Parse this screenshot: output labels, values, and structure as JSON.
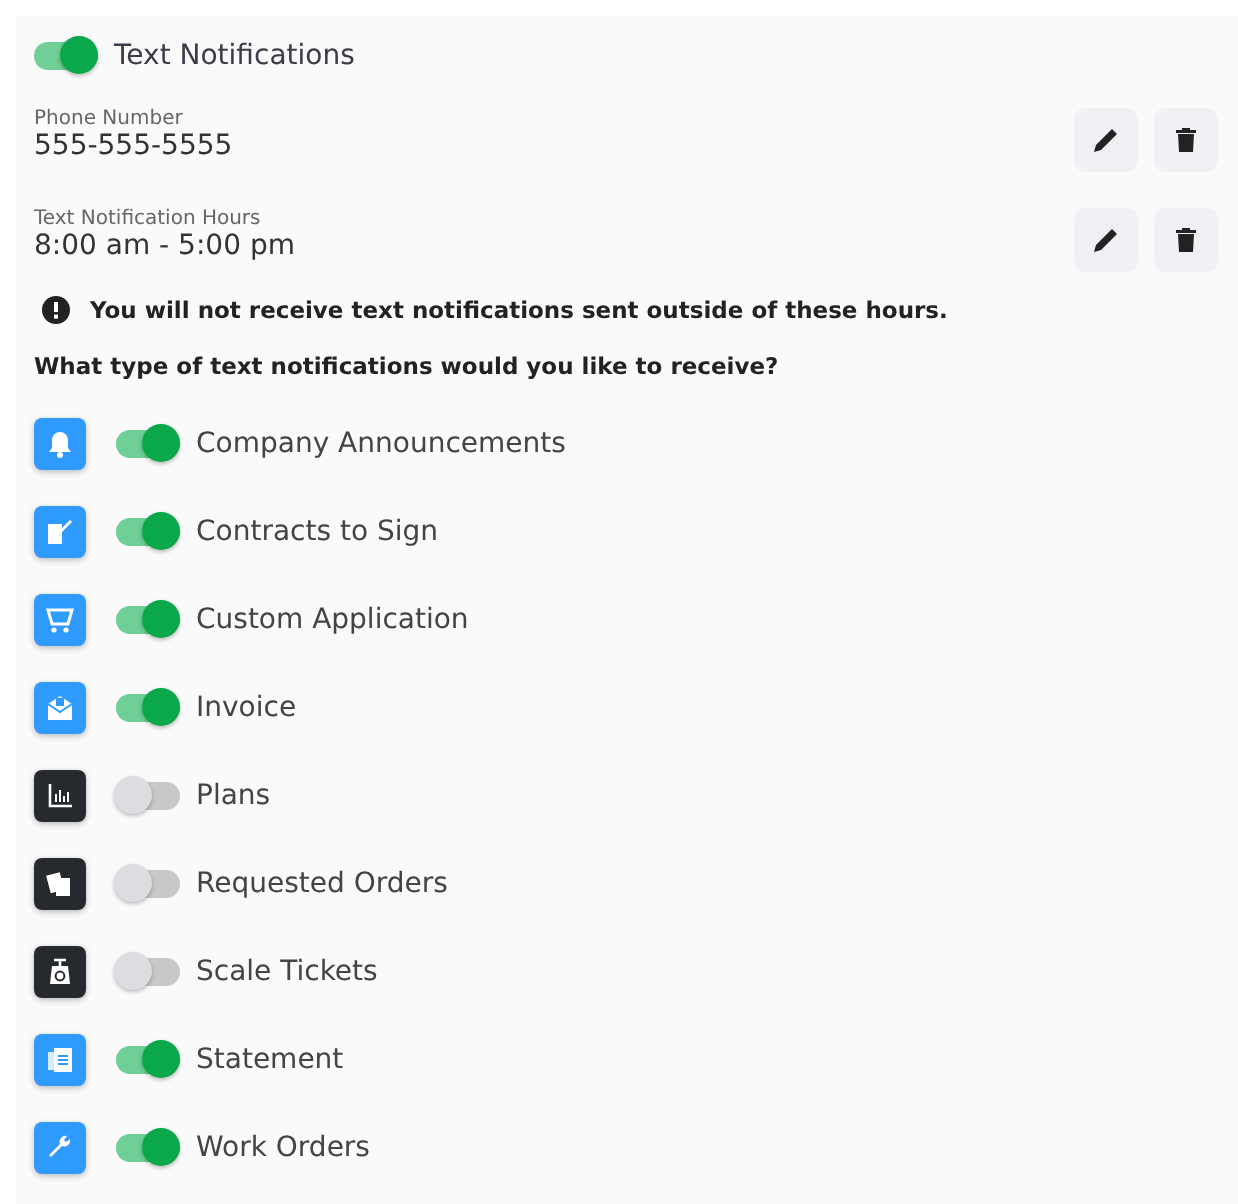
{
  "master": {
    "label": "Text Notifications",
    "on": true
  },
  "fields": [
    {
      "label": "Phone Number",
      "value": "555-555-5555"
    },
    {
      "label": "Text Notification Hours",
      "value": "8:00 am - 5:00 pm"
    }
  ],
  "warning": "You will not receive text notifications sent outside of these hours.",
  "question": "What type of text notifications would you like to receive?",
  "types": [
    {
      "kind": "bell",
      "label": "Company Announcements",
      "on": true
    },
    {
      "kind": "contract",
      "label": "Contracts to Sign",
      "on": true
    },
    {
      "kind": "cart",
      "label": "Custom Application",
      "on": true
    },
    {
      "kind": "invoice",
      "label": "Invoice",
      "on": true
    },
    {
      "kind": "chart",
      "label": "Plans",
      "on": false
    },
    {
      "kind": "orders",
      "label": "Requested Orders",
      "on": false
    },
    {
      "kind": "scale",
      "label": "Scale Tickets",
      "on": false
    },
    {
      "kind": "statement",
      "label": "Statement",
      "on": true
    },
    {
      "kind": "wrench",
      "label": "Work Orders",
      "on": true
    }
  ]
}
